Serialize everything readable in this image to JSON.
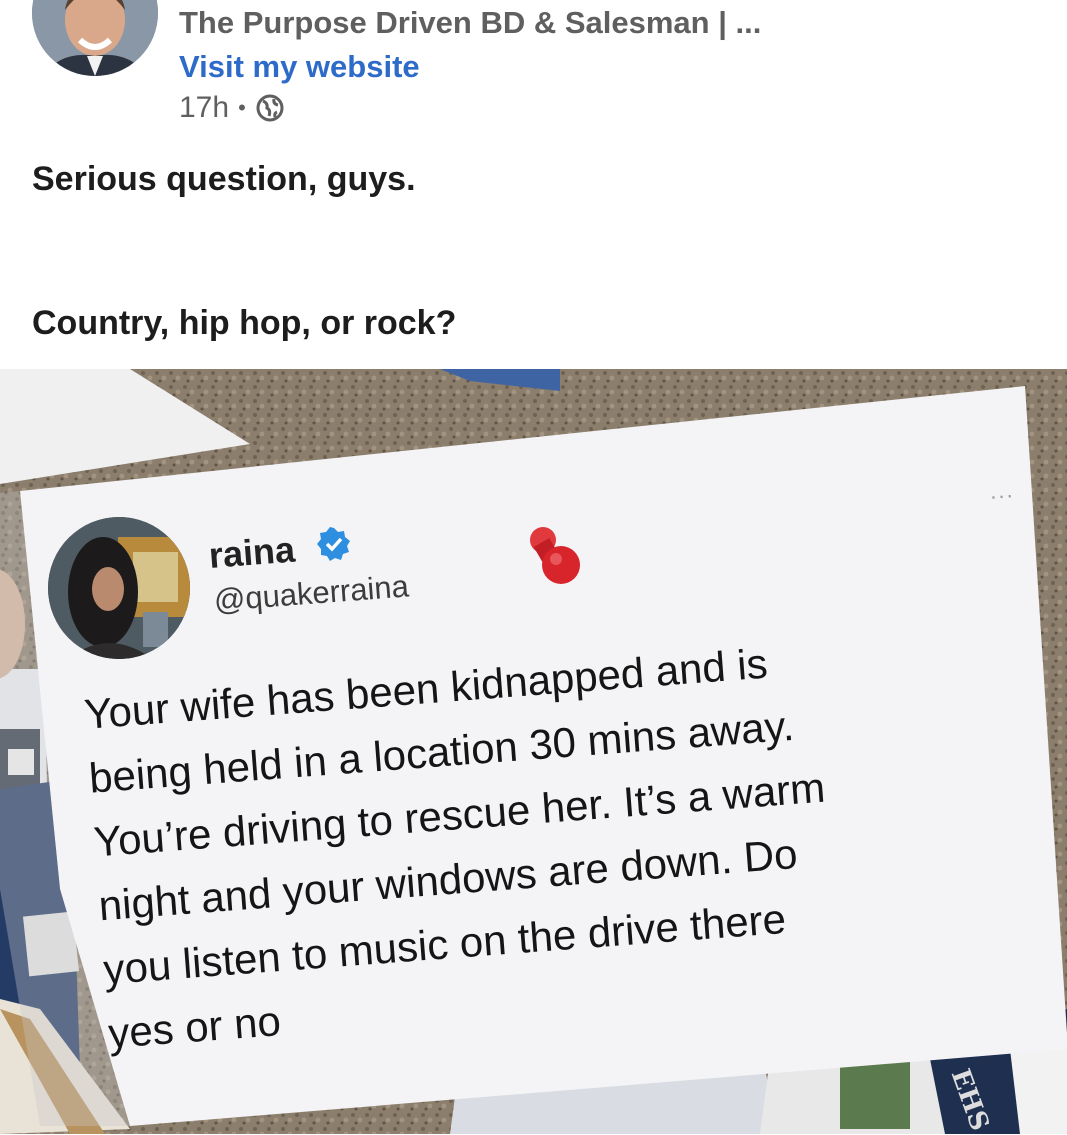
{
  "post": {
    "author_name": "The Purpose Driven BD & Salesman | ...",
    "visit_link": "Visit my website",
    "timestamp": "17h",
    "separator": "•",
    "visibility_icon": "globe-icon",
    "text_line_1": "Serious question, guys.",
    "text_line_2": "Country, hip hop, or rock?"
  },
  "image": {
    "tweet": {
      "display_name": "raina",
      "handle": "@quakerraina",
      "verified_icon": "verified-badge-icon",
      "more_icon": "...",
      "lines": [
        "Your wife has been kidnapped and is",
        "being held in a location 30 mins away.",
        "You’re driving to rescue her. It’s a warm",
        "night and your windows are down. Do",
        "you listen to music on the drive there",
        "yes or no"
      ]
    },
    "sign_fragment": "EHS",
    "colors": {
      "corkboard": "#8c7e6c",
      "paper": "#f4f4f6",
      "pin": "#d8242b",
      "verified": "#2e8fe0"
    }
  }
}
